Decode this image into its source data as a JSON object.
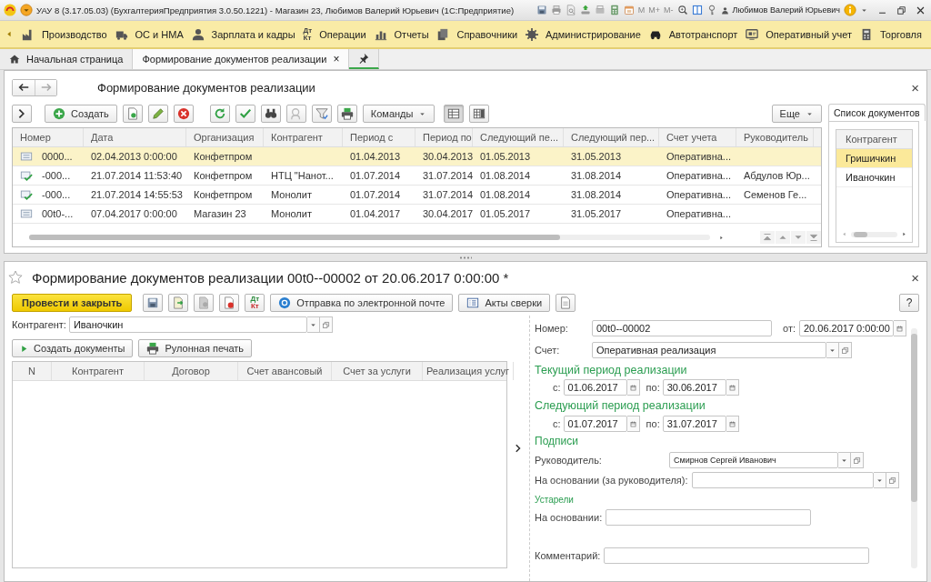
{
  "window": {
    "title": "УАУ 8 (3.17.05.03) (БухгалтерияПредприятия 3.0.50.1221) - Магазин 23, Любимов Валерий Юрьевич (1С:Предприятие)",
    "memory_buttons": [
      "M",
      "M+",
      "M-"
    ],
    "user": "Любимов Валерий Юрьевич"
  },
  "sections": [
    {
      "label": "Производство",
      "kind": "factory"
    },
    {
      "label": "ОС и НМА",
      "kind": "truck"
    },
    {
      "label": "Зарплата и кадры",
      "kind": "person"
    },
    {
      "label": "Операции",
      "kind": "ledger",
      "icon_text": [
        "Дт",
        "Кт"
      ]
    },
    {
      "label": "Отчеты",
      "kind": "bars"
    },
    {
      "label": "Справочники",
      "kind": "books"
    },
    {
      "label": "Администрирование",
      "kind": "gear"
    },
    {
      "label": "Автотранспорт",
      "kind": "car"
    },
    {
      "label": "Оперативный учет",
      "kind": "screen"
    },
    {
      "label": "Торговля",
      "kind": "calc"
    }
  ],
  "tabs": [
    {
      "kind": "home",
      "label": "Начальная страница",
      "selected": false
    },
    {
      "kind": "document",
      "label": "Формирование документов реализации",
      "close": "×",
      "selected": true
    },
    {
      "kind": "pin",
      "selected": false
    }
  ],
  "list_form": {
    "title": "Формирование документов реализации",
    "close": "×",
    "create": "Создать",
    "commands": "Команды",
    "more": "Еще",
    "view_modes": [
      {
        "selected": true
      },
      {
        "selected": false
      }
    ],
    "columns": [
      "Номер",
      "Дата",
      "Организация",
      "Контрагент",
      "Период с",
      "Период по",
      "Следующий пе...",
      "Следующий пер...",
      "Счет учета",
      "Руководитель"
    ],
    "rows": [
      {
        "kind": "draft",
        "selected": true,
        "cells": [
          "0000...",
          "02.04.2013 0:00:00",
          "Конфетпром",
          "",
          "01.04.2013",
          "30.04.2013",
          "01.05.2013",
          "31.05.2013",
          "Оперативна...",
          ""
        ]
      },
      {
        "kind": "posted",
        "selected": false,
        "cells": [
          "-000...",
          "21.07.2014 11:53:40",
          "Конфетпром",
          "НТЦ \"Нанот...",
          "01.07.2014",
          "31.07.2014",
          "01.08.2014",
          "31.08.2014",
          "Оперативна...",
          "Абдулов Юр..."
        ]
      },
      {
        "kind": "posted",
        "selected": false,
        "cells": [
          "-000...",
          "21.07.2014 14:55:53",
          "Конфетпром",
          "Монолит",
          "01.07.2014",
          "31.07.2014",
          "01.08.2014",
          "31.08.2014",
          "Оперативна...",
          "Семенов Ге..."
        ]
      },
      {
        "kind": "draft",
        "selected": false,
        "cells": [
          "00t0-...",
          "07.04.2017 0:00:00",
          "Магазин 23",
          "Монолит",
          "01.04.2017",
          "30.04.2017",
          "01.05.2017",
          "31.05.2017",
          "Оперативна...",
          ""
        ]
      }
    ],
    "side_panel": {
      "tab": "Список документов",
      "column": "Контрагент",
      "rows": [
        {
          "label": "Гришичкин",
          "selected": true
        },
        {
          "label": "Иваночкин",
          "selected": false
        }
      ]
    }
  },
  "document_form": {
    "title": "Формирование документов реализации 00t0--00002 от 20.06.2017 0:00:00 *",
    "close": "×",
    "post_button": "Провести и закрыть",
    "dtkt": [
      "Дт",
      "Кт"
    ],
    "email_button": "Отправка по электронной почте",
    "acts_button": "Акты сверки",
    "help": "?",
    "contractor": {
      "label": "Контрагент:",
      "value": "Иваночкин"
    },
    "actions": [
      "Создать документы",
      "Рулонная печать"
    ],
    "columns": [
      "N",
      "Контрагент",
      "Договор",
      "Счет авансовый",
      "Счет за услуги",
      "Реализация услуг"
    ],
    "number": {
      "label": "Номер:",
      "value": "00t0--00002"
    },
    "date": {
      "label": "от:",
      "value": "20.06.2017 0:00:00"
    },
    "account": {
      "label": "Счет:",
      "value": "Оперативная реализация"
    },
    "periods": [
      {
        "heading": "Текущий период реализации",
        "from_label": "с:",
        "from": "01.06.2017",
        "to_label": "по:",
        "to": "30.06.2017"
      },
      {
        "heading": "Следующий период реализации",
        "from_label": "с:",
        "from": "01.07.2017",
        "to_label": "по:",
        "to": "31.07.2017"
      }
    ],
    "signatures": {
      "heading": "Подписи",
      "manager": {
        "label": "Руководитель:",
        "value": "Смирнов Сергей Иванович"
      },
      "basis": {
        "label": "На основании (за руководителя):"
      }
    },
    "obsolete": {
      "heading": "Устарели",
      "label": "На основании:"
    },
    "comment": {
      "label": "Комментарий:"
    }
  }
}
